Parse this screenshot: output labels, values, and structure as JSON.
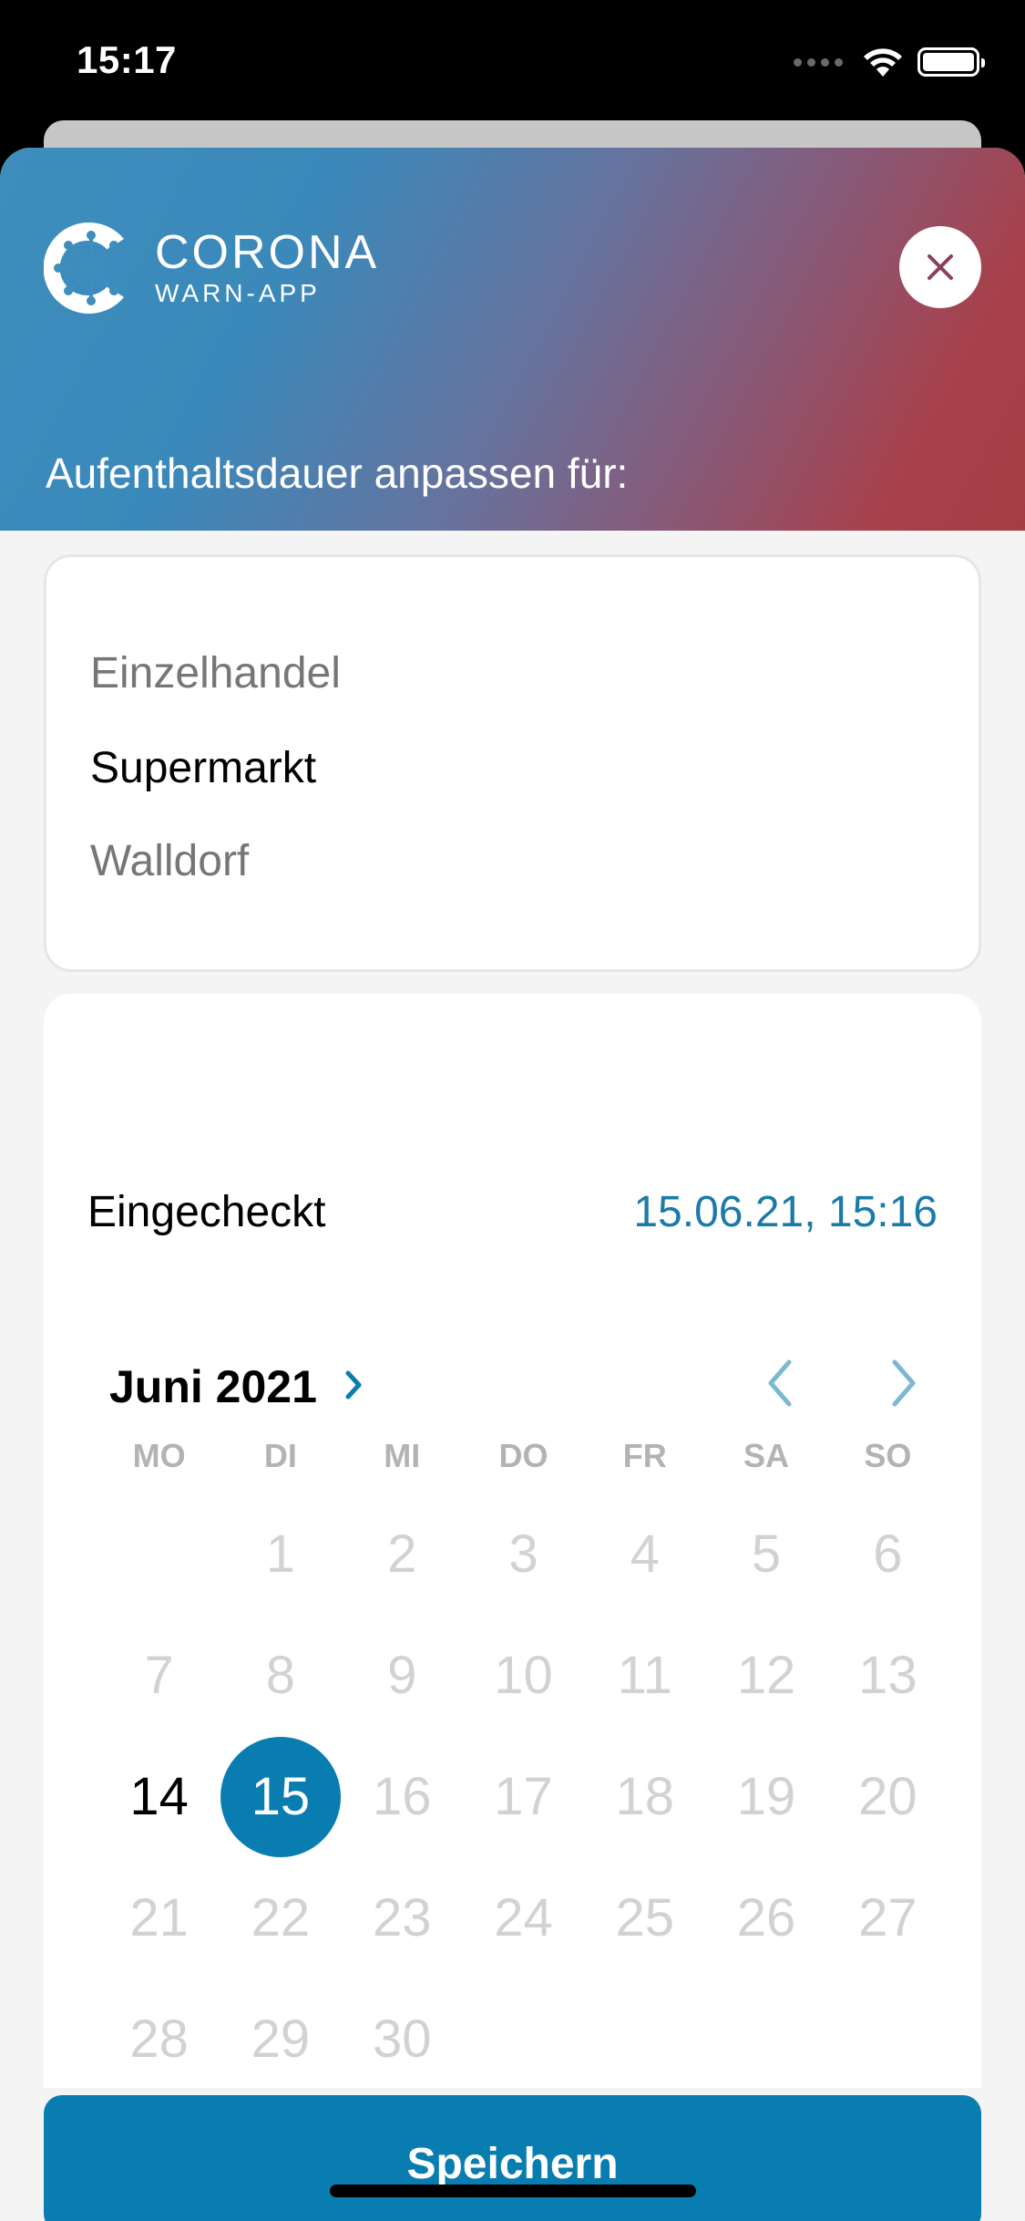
{
  "status_bar": {
    "time": "15:17"
  },
  "header": {
    "logo_title": "CORONA",
    "logo_subtitle": "WARN-APP",
    "title": "Aufenthaltsdauer anpassen für:"
  },
  "location": {
    "type": "Einzelhandel",
    "name": "Supermarkt",
    "address": "Walldorf"
  },
  "checkin": {
    "label": "Eingecheckt",
    "value": "15.06.21, 15:16"
  },
  "calendar": {
    "month_label": "Juni 2021",
    "weekdays": [
      "MO",
      "DI",
      "MI",
      "DO",
      "FR",
      "SA",
      "SO"
    ],
    "first_weekday_offset": 1,
    "days_in_month": 30,
    "selected_day": 15,
    "active_days": [
      14,
      15
    ]
  },
  "actions": {
    "save_label": "Speichern"
  },
  "colors": {
    "accent": "#0a7db0",
    "date_text": "#1a7ba8"
  }
}
